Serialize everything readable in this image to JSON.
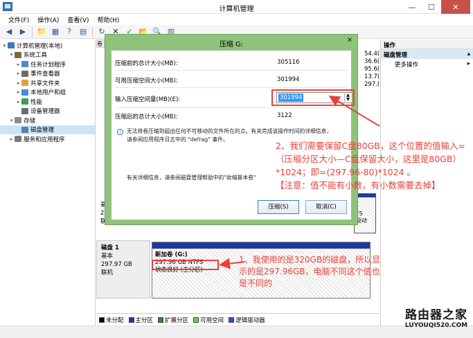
{
  "window": {
    "title": "计算机管理"
  },
  "menu": [
    "文件(F)",
    "操作(A)",
    "查看(V)",
    "帮助(H)"
  ],
  "tree": [
    {
      "label": "计算机管理(本地)",
      "level": 0,
      "exp": "▾"
    },
    {
      "label": "系统工具",
      "level": 1,
      "exp": "▾"
    },
    {
      "label": "任务计划程序",
      "level": 2,
      "exp": "▸"
    },
    {
      "label": "事件查看器",
      "level": 2,
      "exp": "▸"
    },
    {
      "label": "共享文件夹",
      "level": 2,
      "exp": "▸"
    },
    {
      "label": "本地用户和组",
      "level": 2,
      "exp": "▸"
    },
    {
      "label": "性能",
      "level": 2,
      "exp": "▸"
    },
    {
      "label": "设备管理器",
      "level": 2,
      "exp": ""
    },
    {
      "label": "存储",
      "level": 1,
      "exp": "▾"
    },
    {
      "label": "磁盘管理",
      "level": 2,
      "exp": "",
      "selected": true
    },
    {
      "label": "服务和应用程序",
      "level": 1,
      "exp": "▸"
    }
  ],
  "center": {
    "col_header": "卷",
    "right_numbers": [
      "54.4(",
      "36.6(",
      "95.6(",
      "13.7(",
      "297.("
    ],
    "disk0": {
      "lines": [
        "基",
        "29",
        "联"
      ],
      "part_text": [
        "FS",
        "驱动"
      ]
    },
    "disk1": {
      "name": "磁盘 1",
      "type": "基本",
      "size": "297.97 GB",
      "status": "联机",
      "part_name": "新加卷 (G:)",
      "part_size": "297.96 GB NTFS",
      "part_status": "状态良好 (主分区)"
    },
    "legend": [
      {
        "label": "未分配",
        "color": "#000000"
      },
      {
        "label": "主分区",
        "color": "#1f3a9e"
      },
      {
        "label": "扩展分区",
        "color": "#2e8b2e"
      },
      {
        "label": "可用空间",
        "color": "#5fcf4f"
      },
      {
        "label": "逻辑驱动器",
        "color": "#2255cc"
      }
    ]
  },
  "actions": {
    "header": "操作",
    "section": "磁盘管理",
    "items": [
      "更多操作"
    ]
  },
  "dialog": {
    "title": "压缩 G:",
    "rows": [
      {
        "label": "压缩前的总计大小(MB):",
        "value": "305116"
      },
      {
        "label": "可用压缩空间大小(MB):",
        "value": "301994"
      },
      {
        "label": "输入压缩空间量(MB)(E):",
        "value": ""
      },
      {
        "label": "压缩后的总计大小(MB):",
        "value": "3122"
      }
    ],
    "input_value": "301994",
    "info": "无法将卷压缩到超出任何不可移动的文件所在的点。有关完成该操作时间的详细信息，请参阅应用程序日志中的 \"defrag\" 事件。",
    "help": "有关详细信息，请参阅磁盘管理帮助中的\"收缩基本卷\"",
    "ok": "压缩(S)",
    "cancel": "取消(C)"
  },
  "annotations": {
    "note1": "1、我使用的是320GB的磁盘，所以显示的是297.96GB，电脑不同这个值也是不同的",
    "note2": "2、我们需要保留C盘80GB，这个位置的值输入=（压缩分区大小—C盘保留大小，这里是80GB）*1024；即=(297.96-80)*1024 。",
    "note2_warning": "【注意：值不能有小数，有小数需要去掉】"
  },
  "watermark": {
    "main": "路由器之家",
    "sub": "LUYOUQI520.COM"
  }
}
